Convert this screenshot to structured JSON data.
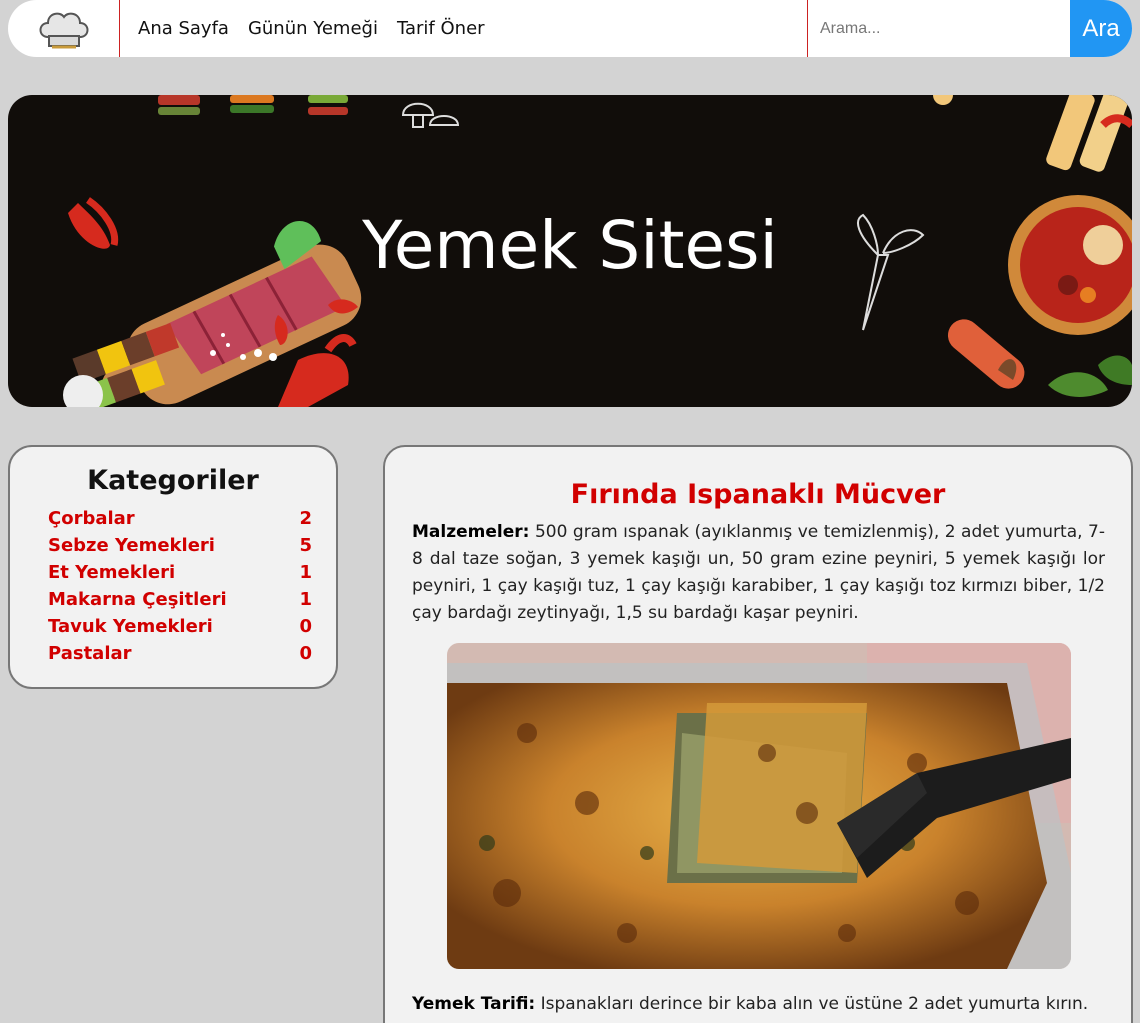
{
  "nav": {
    "logo_icon": "chef-hat-icon",
    "links": [
      "Ana Sayfa",
      "Günün Yemeği",
      "Tarif Öner"
    ],
    "search_placeholder": "Arama...",
    "search_button": "Ara",
    "accent_color": "#2196f3"
  },
  "banner": {
    "title": "Yemek Sitesi"
  },
  "sidebar": {
    "title": "Kategoriler",
    "categories": [
      {
        "name": "Çorbalar",
        "count": "2"
      },
      {
        "name": "Sebze Yemekleri",
        "count": "5"
      },
      {
        "name": "Et Yemekleri",
        "count": "1"
      },
      {
        "name": "Makarna Çeşitleri",
        "count": "1"
      },
      {
        "name": "Tavuk Yemekleri",
        "count": "0"
      },
      {
        "name": "Pastalar",
        "count": "0"
      }
    ]
  },
  "recipe": {
    "title": "Fırında Ispanaklı Mücver",
    "ingredients_label": "Malzemeler:",
    "ingredients_text": "500 gram ıspanak (ayıklanmış ve temizlenmiş), 2 adet yumurta, 7-8 dal taze soğan, 3 yemek kaşığı un, 50 gram ezine peyniri, 5 yemek kaşığı lor peyniri, 1 çay kaşığı tuz, 1 çay kaşığı karabiber, 1 çay kaşığı toz kırmızı biber, 1/2 çay bardağı zeytinyağı, 1,5 su bardağı kaşar peyniri.",
    "method_label": "Yemek Tarifi:",
    "method_text": "Ispanakları derince bir kaba alın ve üstüne 2 adet yumurta kırın."
  },
  "colors": {
    "category_red": "#d10000",
    "background": "#d3d3d3"
  }
}
